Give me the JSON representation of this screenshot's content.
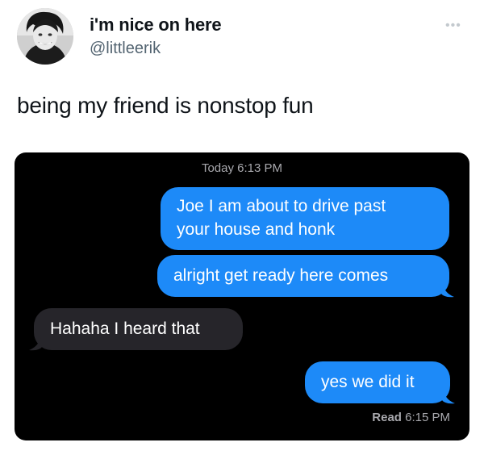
{
  "tweet": {
    "display_name": "i'm nice on here",
    "handle": "@littleerik",
    "more_icon": "more-horizontal-icon",
    "text": "being my friend is nonstop fun"
  },
  "conversation": {
    "timestamp_day": "Today",
    "timestamp_time": "6:13 PM",
    "messages": [
      {
        "from": "me",
        "lines": [
          "Joe I am about to drive past",
          "your house and honk"
        ]
      },
      {
        "from": "me",
        "lines": [
          "alright get ready here comes"
        ]
      },
      {
        "from": "them",
        "lines": [
          "Hahaha I heard that"
        ]
      },
      {
        "from": "me",
        "lines": [
          "yes we did it"
        ]
      }
    ],
    "read_label": "Read",
    "read_time": "6:15 PM"
  },
  "colors": {
    "outgoing_bubble": "#1d8af8",
    "incoming_bubble": "#26252a",
    "chat_background": "#000000",
    "meta_text": "#a8a8ad"
  }
}
